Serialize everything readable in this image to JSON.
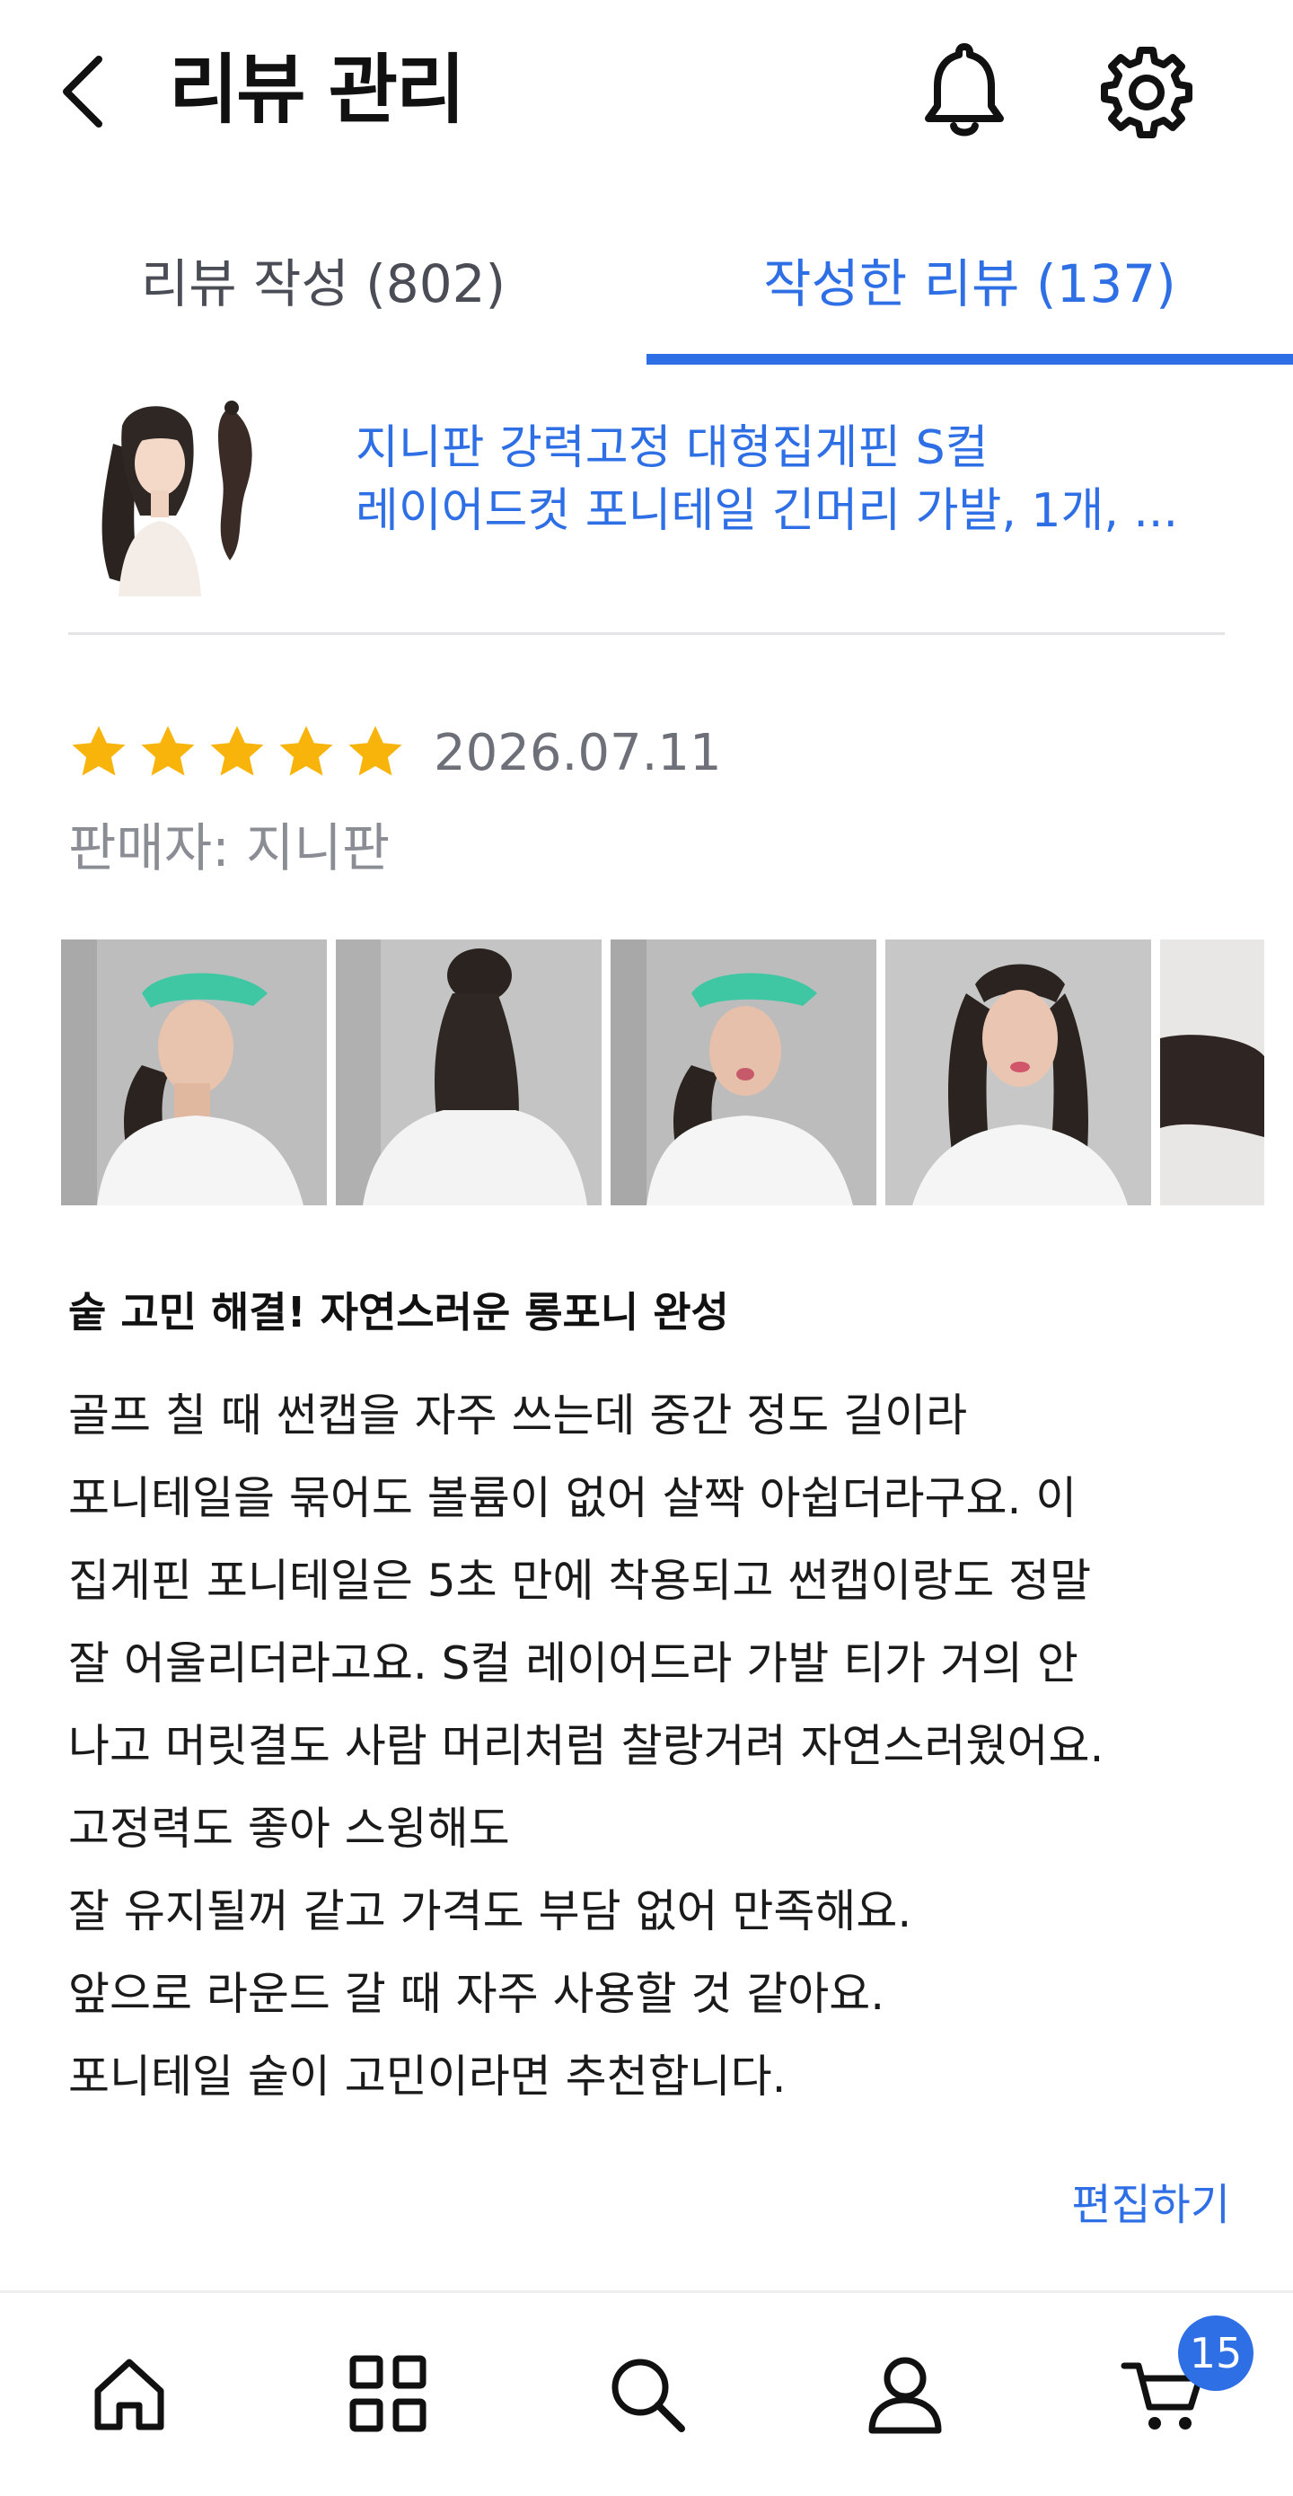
{
  "header": {
    "title": "리뷰 관리",
    "back_icon": "chevron-left-icon",
    "bell_icon": "bell-icon",
    "settings_icon": "gear-icon"
  },
  "tabs": [
    {
      "label": "리뷰 작성 (802)",
      "active": false
    },
    {
      "label": "작성한 리뷰 (137)",
      "active": true
    }
  ],
  "product": {
    "name_line1": "지니판 강력고정 대형집게핀 S컬",
    "name_line2": "레이어드컷 포니테일 긴머리 가발, 1개, ..."
  },
  "review": {
    "stars": 5,
    "date": "2026.07.11",
    "seller": "판매자: 지니판",
    "photo_count_visible": 5,
    "title": "숱 고민 해결! 자연스러운 롱포니 완성",
    "body_lines": [
      "골프 칠 때 썬캡을 자주 쓰는데 중간 정도 길이라",
      "포니테일을 묶어도 볼륨이 없어 살짝 아쉽더라구요. 이",
      "집게핀 포니테일은 5초 만에 착용되고 썬캡이랑도 정말",
      "잘 어울리더라고요. S컬 레이어드라 가발 티가 거의 안",
      "나고 머릿결도 사람 머리처럼 찰랑거려 자연스러웠어요.",
      "고정력도 좋아 스윙해도",
      "잘 유지될꺼 같고 가격도 부담 없어 만족해요.",
      "앞으로 라운드 갈 때 자주 사용할 것 같아요.",
      "포니테일 숱이 고민이라면 추천합니다."
    ],
    "edit_label": "편집하기"
  },
  "bottom_nav": {
    "items": [
      "home-icon",
      "grid-icon",
      "search-icon",
      "user-icon",
      "cart-icon"
    ],
    "cart_badge": "15"
  },
  "colors": {
    "accent": "#2e6fe6",
    "star": "#f8b40a",
    "muted": "#8a8d94"
  }
}
